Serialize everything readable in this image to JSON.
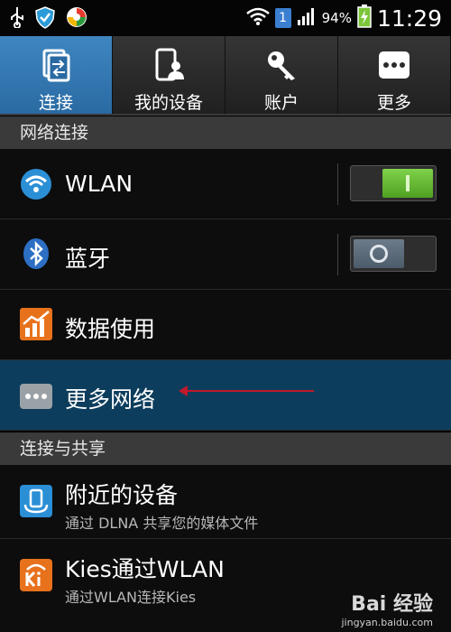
{
  "status_bar": {
    "time": "11:29",
    "battery_percent": "94%",
    "notification_count": "1",
    "icons": [
      "usb-icon",
      "shield-icon",
      "sync-app-icon",
      "wifi-signal-icon",
      "cell-signal-icon",
      "battery-charging-icon"
    ]
  },
  "tabs": [
    {
      "label": "连接",
      "icon": "connections-icon",
      "active": true
    },
    {
      "label": "我的设备",
      "icon": "my-device-icon",
      "active": false
    },
    {
      "label": "账户",
      "icon": "key-icon",
      "active": false
    },
    {
      "label": "更多",
      "icon": "more-dots-icon",
      "active": false
    }
  ],
  "sections": {
    "network": "网络连接",
    "sharing": "连接与共享"
  },
  "rows": {
    "wlan": {
      "label": "WLAN",
      "toggle": "on"
    },
    "bluetooth": {
      "label": "蓝牙",
      "toggle": "off"
    },
    "data_usage": {
      "label": "数据使用"
    },
    "more_networks": {
      "label": "更多网络",
      "highlighted": true
    },
    "nearby_devices": {
      "label": "附近的设备",
      "sub": "通过 DLNA 共享您的媒体文件"
    },
    "kies_wlan": {
      "label": "Kies通过WLAN",
      "sub": "通过WLAN连接Kies"
    }
  },
  "colors": {
    "active_tab": "#3f86c0",
    "highlight_row": "#0d3d5c",
    "toggle_on": "#5fb82e",
    "annotation_arrow": "#c0192b"
  },
  "watermark": {
    "main": "Bai 经验",
    "url": "jingyan.baidu.com"
  }
}
